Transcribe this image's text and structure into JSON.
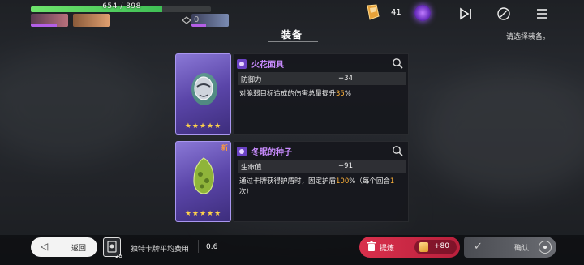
{
  "hud": {
    "hp_text": "654 / 898",
    "hp_fraction": 0.728,
    "buff_count": "0"
  },
  "top": {
    "resource_count": "41"
  },
  "screen": {
    "title": "装备",
    "hint": "请选择装备。"
  },
  "equipment": [
    {
      "name": "火花面具",
      "stat_label": "防御力",
      "stat_value": "+34",
      "desc_a": "对脆弱目标造成的伤害总量提升",
      "desc_hl": "35",
      "desc_b": "%",
      "stars": "★★★★★",
      "new_tag": ""
    },
    {
      "name": "冬眠的种子",
      "stat_label": "生命值",
      "stat_value": "+91",
      "desc_a": "通过卡牌获得护盾时，固定护盾",
      "desc_hl": "100",
      "desc_b": "%（每个回合",
      "desc_hl2": "1",
      "desc_c": "次）",
      "stars": "★★★★★",
      "new_tag": "新"
    }
  ],
  "bottom": {
    "back_label": "返回",
    "deck_count": "25",
    "avg_cost_label": "独特卡牌平均费用",
    "avg_cost_value": "0.6",
    "refine_label": "提炼",
    "refine_gain": "+80",
    "confirm_label": "确认"
  },
  "colors": {
    "accent_purple": "#c98cff",
    "highlight": "#ffb23a",
    "hp_green": "#5fd164",
    "refine_red": "#d9304c"
  }
}
